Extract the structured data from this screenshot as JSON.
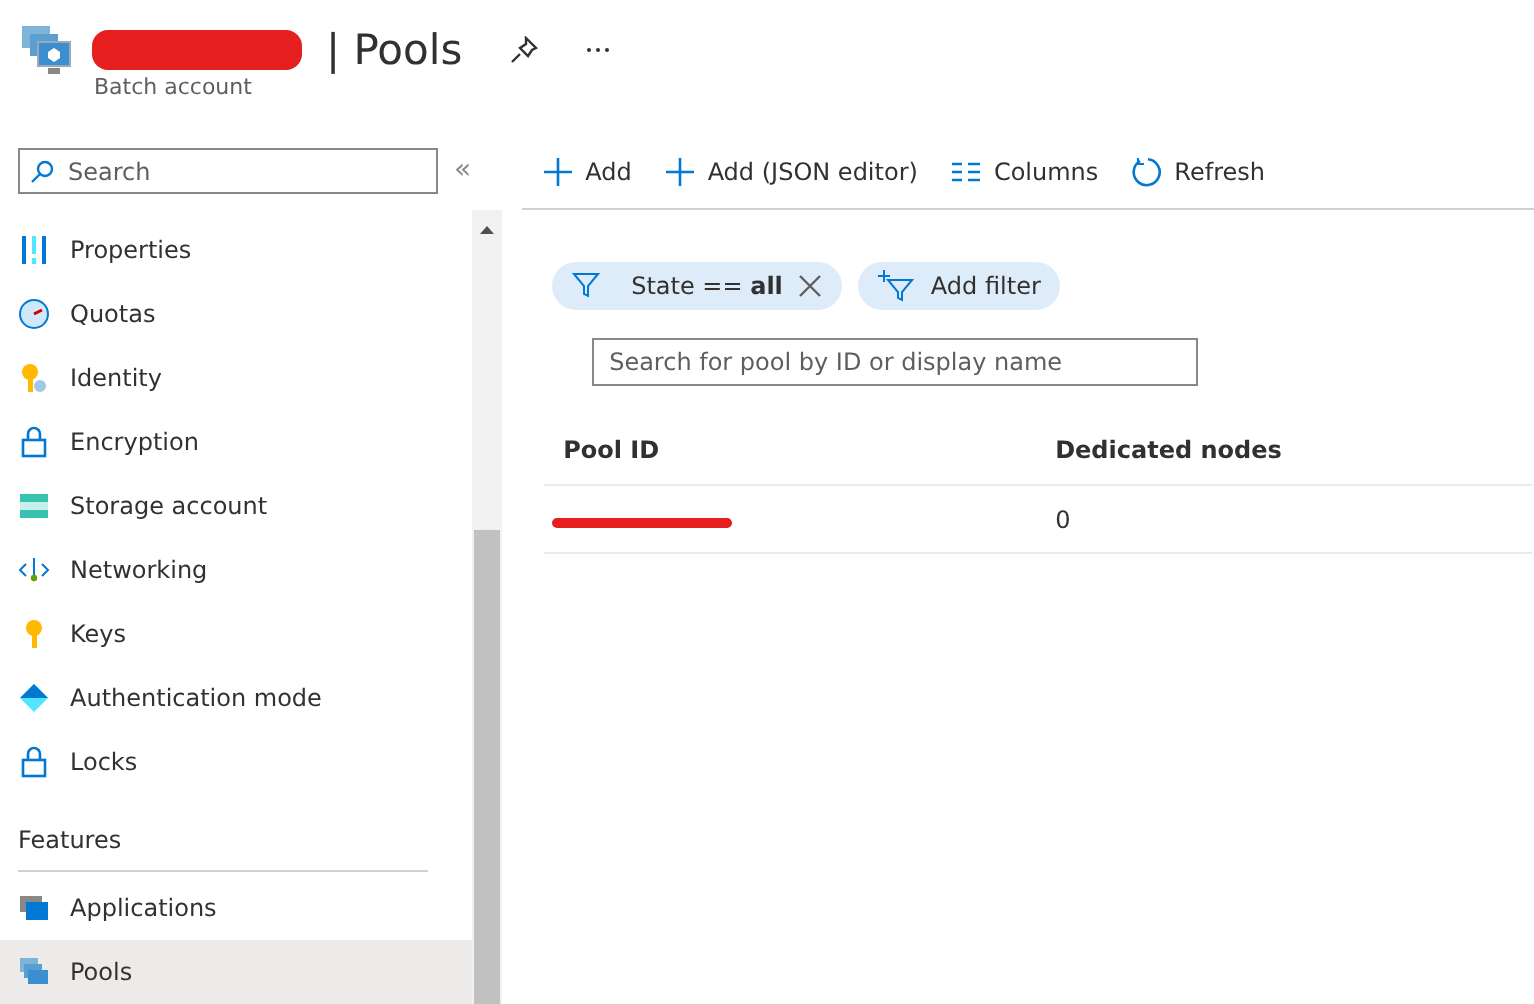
{
  "header": {
    "title": "| Pools",
    "subtitle": "Batch account"
  },
  "sidebar": {
    "search_placeholder": "Search",
    "collapse": "«",
    "items": [
      {
        "label": "Properties",
        "selected": false
      },
      {
        "label": "Quotas",
        "selected": false
      },
      {
        "label": "Identity",
        "selected": false
      },
      {
        "label": "Encryption",
        "selected": false
      },
      {
        "label": "Storage account",
        "selected": false
      },
      {
        "label": "Networking",
        "selected": false
      },
      {
        "label": "Keys",
        "selected": false
      },
      {
        "label": "Authentication mode",
        "selected": false
      },
      {
        "label": "Locks",
        "selected": false
      }
    ],
    "section": {
      "title": "Features",
      "items": [
        {
          "label": "Applications",
          "selected": false
        },
        {
          "label": "Pools",
          "selected": true
        }
      ]
    }
  },
  "toolbar": [
    "Add",
    "Add (JSON editor)",
    "Columns",
    "Refresh"
  ],
  "filters": {
    "chip": "State == **all**",
    "add": "Add filter"
  },
  "pool_search": {
    "placeholder": "Search for pool by ID or display name"
  },
  "table": {
    "columns": [
      "Pool ID",
      "Dedicated nodes"
    ],
    "rows": [
      {
        "dedicated_nodes": "0"
      }
    ]
  }
}
